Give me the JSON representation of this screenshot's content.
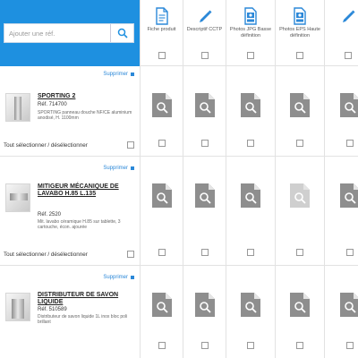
{
  "search": {
    "placeholder": "Ajouter une réf."
  },
  "columns": [
    {
      "label": "Fiche produit",
      "icon": "document-icon"
    },
    {
      "label": "Descriptif CCTP",
      "icon": "pencil-icon"
    },
    {
      "label": "Photos JPG Basse définition",
      "icon": "photo-file-icon"
    },
    {
      "label": "Photos EPS Haute définition",
      "icon": "photo-file-icon"
    },
    {
      "label": "",
      "icon": "pencil-icon"
    }
  ],
  "rows": [
    {
      "delete_label": "Supprimer",
      "title": "SPORTING 2",
      "ref": "Réf. 714700",
      "description": "SPORTING panneau douche NF/CE aluminium anodisé, H. 1100mm",
      "select_all_label": "Tout sélectionner / désélectionner",
      "disabled_cells": []
    },
    {
      "delete_label": "Supprimer",
      "title": "MITIGEUR MÉCANIQUE DE LAVABO H.85 L.135",
      "ref": "Réf. 2520",
      "description": "Mit. lavabo céramique H.85 sur tablette, 3 cartouche, écon. ajourée",
      "select_all_label": "Tout sélectionner / désélectionner",
      "disabled_cells": [
        3
      ]
    },
    {
      "delete_label": "Supprimer",
      "title": "DISTRIBUTEUR DE SAVON LIQUIDE",
      "ref": "Réf. 510589",
      "description": "Distributeur de savon liquide 1L inox bloc poli brillant",
      "select_all_label": "",
      "disabled_cells": []
    }
  ],
  "colors": {
    "header_blue": "#1e90e0",
    "link_blue": "#2b88d8",
    "doc_gray": "#8e8e8e",
    "doc_disabled": "#cfcfcf"
  }
}
